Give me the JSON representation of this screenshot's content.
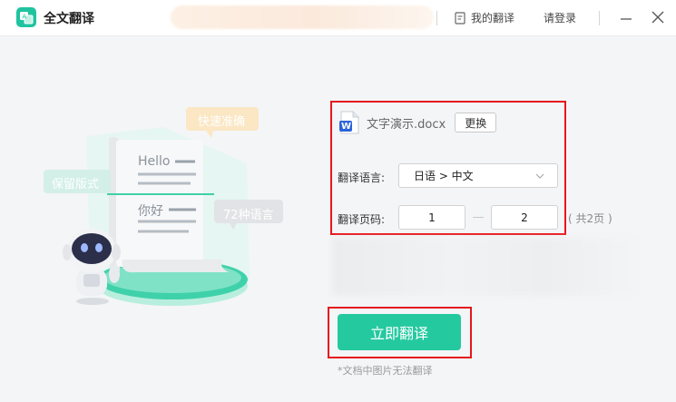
{
  "app": {
    "title": "全文翻译"
  },
  "header": {
    "my_translations": "我的翻译",
    "login": "请登录"
  },
  "illustration": {
    "tag_fast": "快速准确",
    "tag_layout": "保留版式",
    "tag_languages": "72种语言",
    "word_hello": "Hello",
    "word_nihao": "你好"
  },
  "file": {
    "name": "文字演示.docx",
    "change_label": "更换",
    "icon_letter": "W"
  },
  "form": {
    "language_label": "翻译语言:",
    "language_value": "日语 > 中文",
    "pages_label": "翻译页码:",
    "page_from": "1",
    "page_to": "2",
    "total_pages": "( 共2页 )"
  },
  "actions": {
    "translate_label": "立即翻译"
  },
  "note": "*文档中图片无法翻译",
  "colors": {
    "accent": "#25c9a0",
    "highlight": "#e5161c",
    "doc_blue": "#2b63d8"
  }
}
